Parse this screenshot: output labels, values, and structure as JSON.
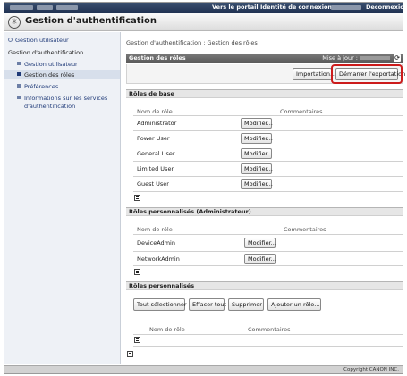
{
  "topbar": {
    "portal_link": "Vers le portail",
    "login_label": "Identité de connexion :",
    "logout": "Deconnexion"
  },
  "app": {
    "title": "Gestion d'authentification",
    "logo_icon": "gear-icon"
  },
  "sidebar": {
    "user_mgmt_root": "Gestion utilisateur",
    "auth_mgmt": "Gestion d'authentification",
    "items": [
      {
        "label": "Gestion utilisateur"
      },
      {
        "label": "Gestion des rôles"
      },
      {
        "label": "Préférences"
      },
      {
        "label": "Informations sur les services"
      },
      {
        "label": "d'authentification"
      }
    ]
  },
  "main": {
    "breadcrumb": "Gestion d'authentification : Gestion des rôles",
    "header": {
      "title": "Gestion des rôles",
      "updated_label": "Mise à jour :",
      "refresh_icon": "refresh-icon"
    },
    "buttons": {
      "import": "Importation...",
      "export": "Démarrer l'exportation"
    },
    "basic_roles": {
      "title": "Rôles de base",
      "col_name": "Nom de rôle",
      "col_comments": "Commentaires",
      "rows": [
        {
          "name": "Administrator",
          "action": "Modifier..."
        },
        {
          "name": "Power User",
          "action": "Modifier..."
        },
        {
          "name": "General User",
          "action": "Modifier..."
        },
        {
          "name": "Limited User",
          "action": "Modifier..."
        },
        {
          "name": "Guest User",
          "action": "Modifier..."
        }
      ]
    },
    "custom_admin": {
      "title": "Rôles personnalisés (Administrateur)",
      "col_name": "Nom de rôle",
      "col_comments": "Commentaires",
      "rows": [
        {
          "name": "DeviceAdmin",
          "action": "Modifier..."
        },
        {
          "name": "NetworkAdmin",
          "action": "Modifier..."
        }
      ]
    },
    "custom": {
      "title": "Rôles personnalisés",
      "select_all": "Tout sélectionner",
      "clear_all": "Effacer tout",
      "delete": "Supprimer",
      "add_role": "Ajouter un rôle...",
      "col_name": "Nom de rôle",
      "col_comments": "Commentaires"
    }
  },
  "footer": {
    "copyright": "Copyright CANON INC."
  }
}
